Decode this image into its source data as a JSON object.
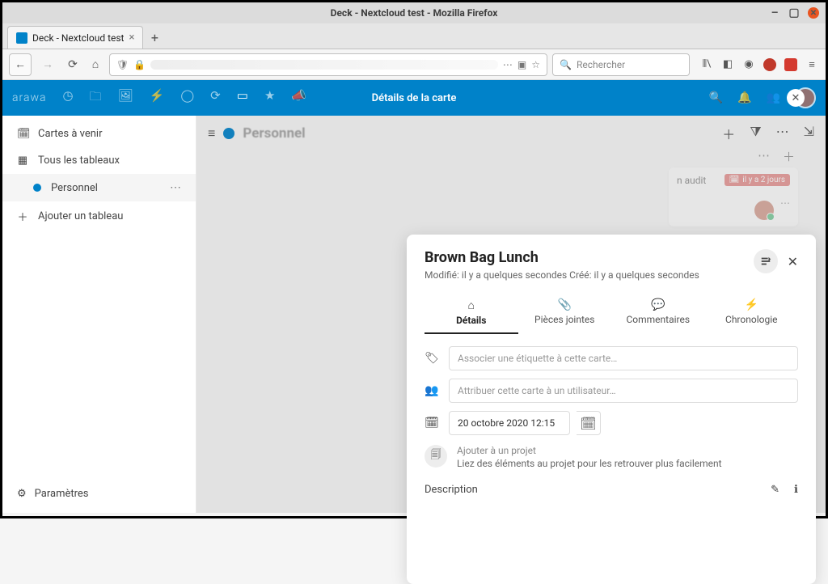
{
  "window": {
    "title": "Deck - Nextcloud test - Mozilla Firefox"
  },
  "tab": {
    "title": "Deck - Nextcloud test"
  },
  "toolbar": {
    "search_placeholder": "Rechercher"
  },
  "nc": {
    "logo": "arawa",
    "header_title": "Détails de la carte"
  },
  "sidebar": {
    "upcoming": "Cartes à venir",
    "all_boards": "Tous les tableaux",
    "board_personal": "Personnel",
    "add_board": "Ajouter un tableau",
    "settings": "Paramètres"
  },
  "board": {
    "bg_card_text": "n audit",
    "bg_badge": "il y a 2 jours"
  },
  "modal": {
    "title": "Brown Bag Lunch",
    "subtitle": "Modifié: il y a quelques secondes Créé: il y a quelques secondes",
    "tabs": {
      "details": "Détails",
      "attachments": "Pièces jointes",
      "comments": "Commentaires",
      "timeline": "Chronologie"
    },
    "tag_placeholder": "Associer une étiquette à cette carte…",
    "assign_placeholder": "Attribuer cette carte à un utilisateur…",
    "due_value": "20 octobre 2020 12:15",
    "project_title": "Ajouter à un projet",
    "project_hint": "Liez des éléments au projet pour les retrouver plus facilement",
    "description_label": "Description"
  }
}
